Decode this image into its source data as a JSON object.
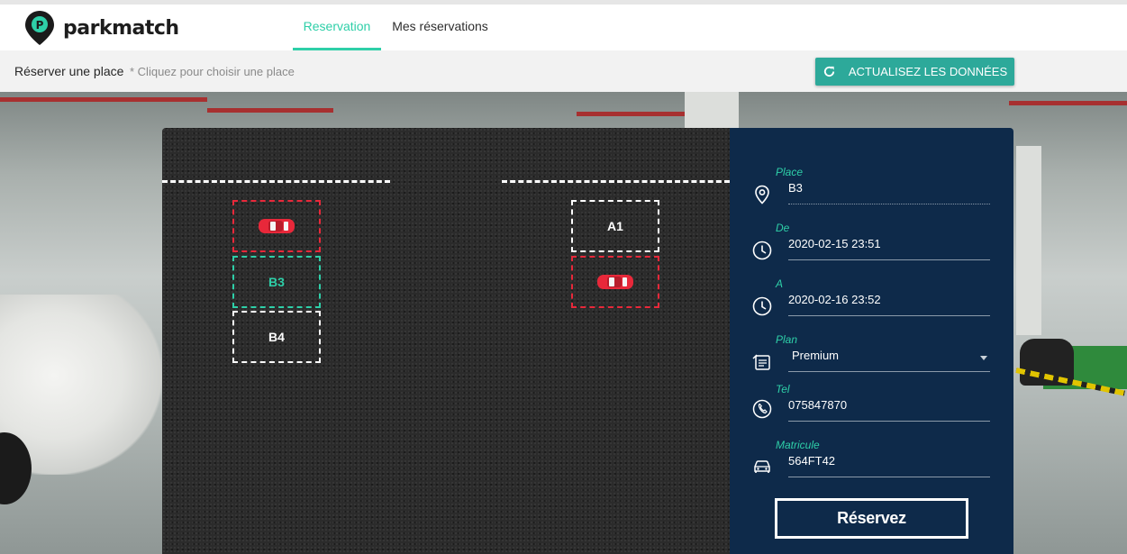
{
  "brand": {
    "name": "parkmatch",
    "color": "#2ecfa8"
  },
  "nav": {
    "tabs": [
      {
        "label": "Reservation",
        "active": true
      },
      {
        "label": "Mes réservations",
        "active": false
      }
    ]
  },
  "subbar": {
    "title": "Réserver une place",
    "hint": "* Cliquez pour choisir une place",
    "refresh_label": "ACTUALISEZ LES DONNÉES",
    "refresh_color": "#2da99a"
  },
  "map": {
    "spots": [
      {
        "id": "B-top",
        "label": "",
        "status": "taken"
      },
      {
        "id": "B3",
        "label": "B3",
        "status": "selected"
      },
      {
        "id": "B4",
        "label": "B4",
        "status": "free"
      },
      {
        "id": "A1",
        "label": "A1",
        "status": "free"
      },
      {
        "id": "A2",
        "label": "",
        "status": "taken"
      }
    ],
    "colors": {
      "free": "#ffffff",
      "taken": "#e8283a",
      "selected": "#2ecfa8"
    }
  },
  "form": {
    "fields": [
      {
        "label": "Place",
        "value": "B3",
        "icon": "location-pin-icon"
      },
      {
        "label": "De",
        "value": "2020-02-15 23:51",
        "icon": "clock-icon"
      },
      {
        "label": "A",
        "value": "2020-02-16 23:52",
        "icon": "clock-icon"
      },
      {
        "label": "Plan",
        "value": "Premium",
        "icon": "price-tag-icon"
      },
      {
        "label": "Tel",
        "value": "075847870",
        "icon": "phone-icon"
      },
      {
        "label": "Matricule",
        "value": "564FT42",
        "icon": "car-icon"
      }
    ],
    "submit_label": "Réservez",
    "background": "#0e2a4a"
  }
}
